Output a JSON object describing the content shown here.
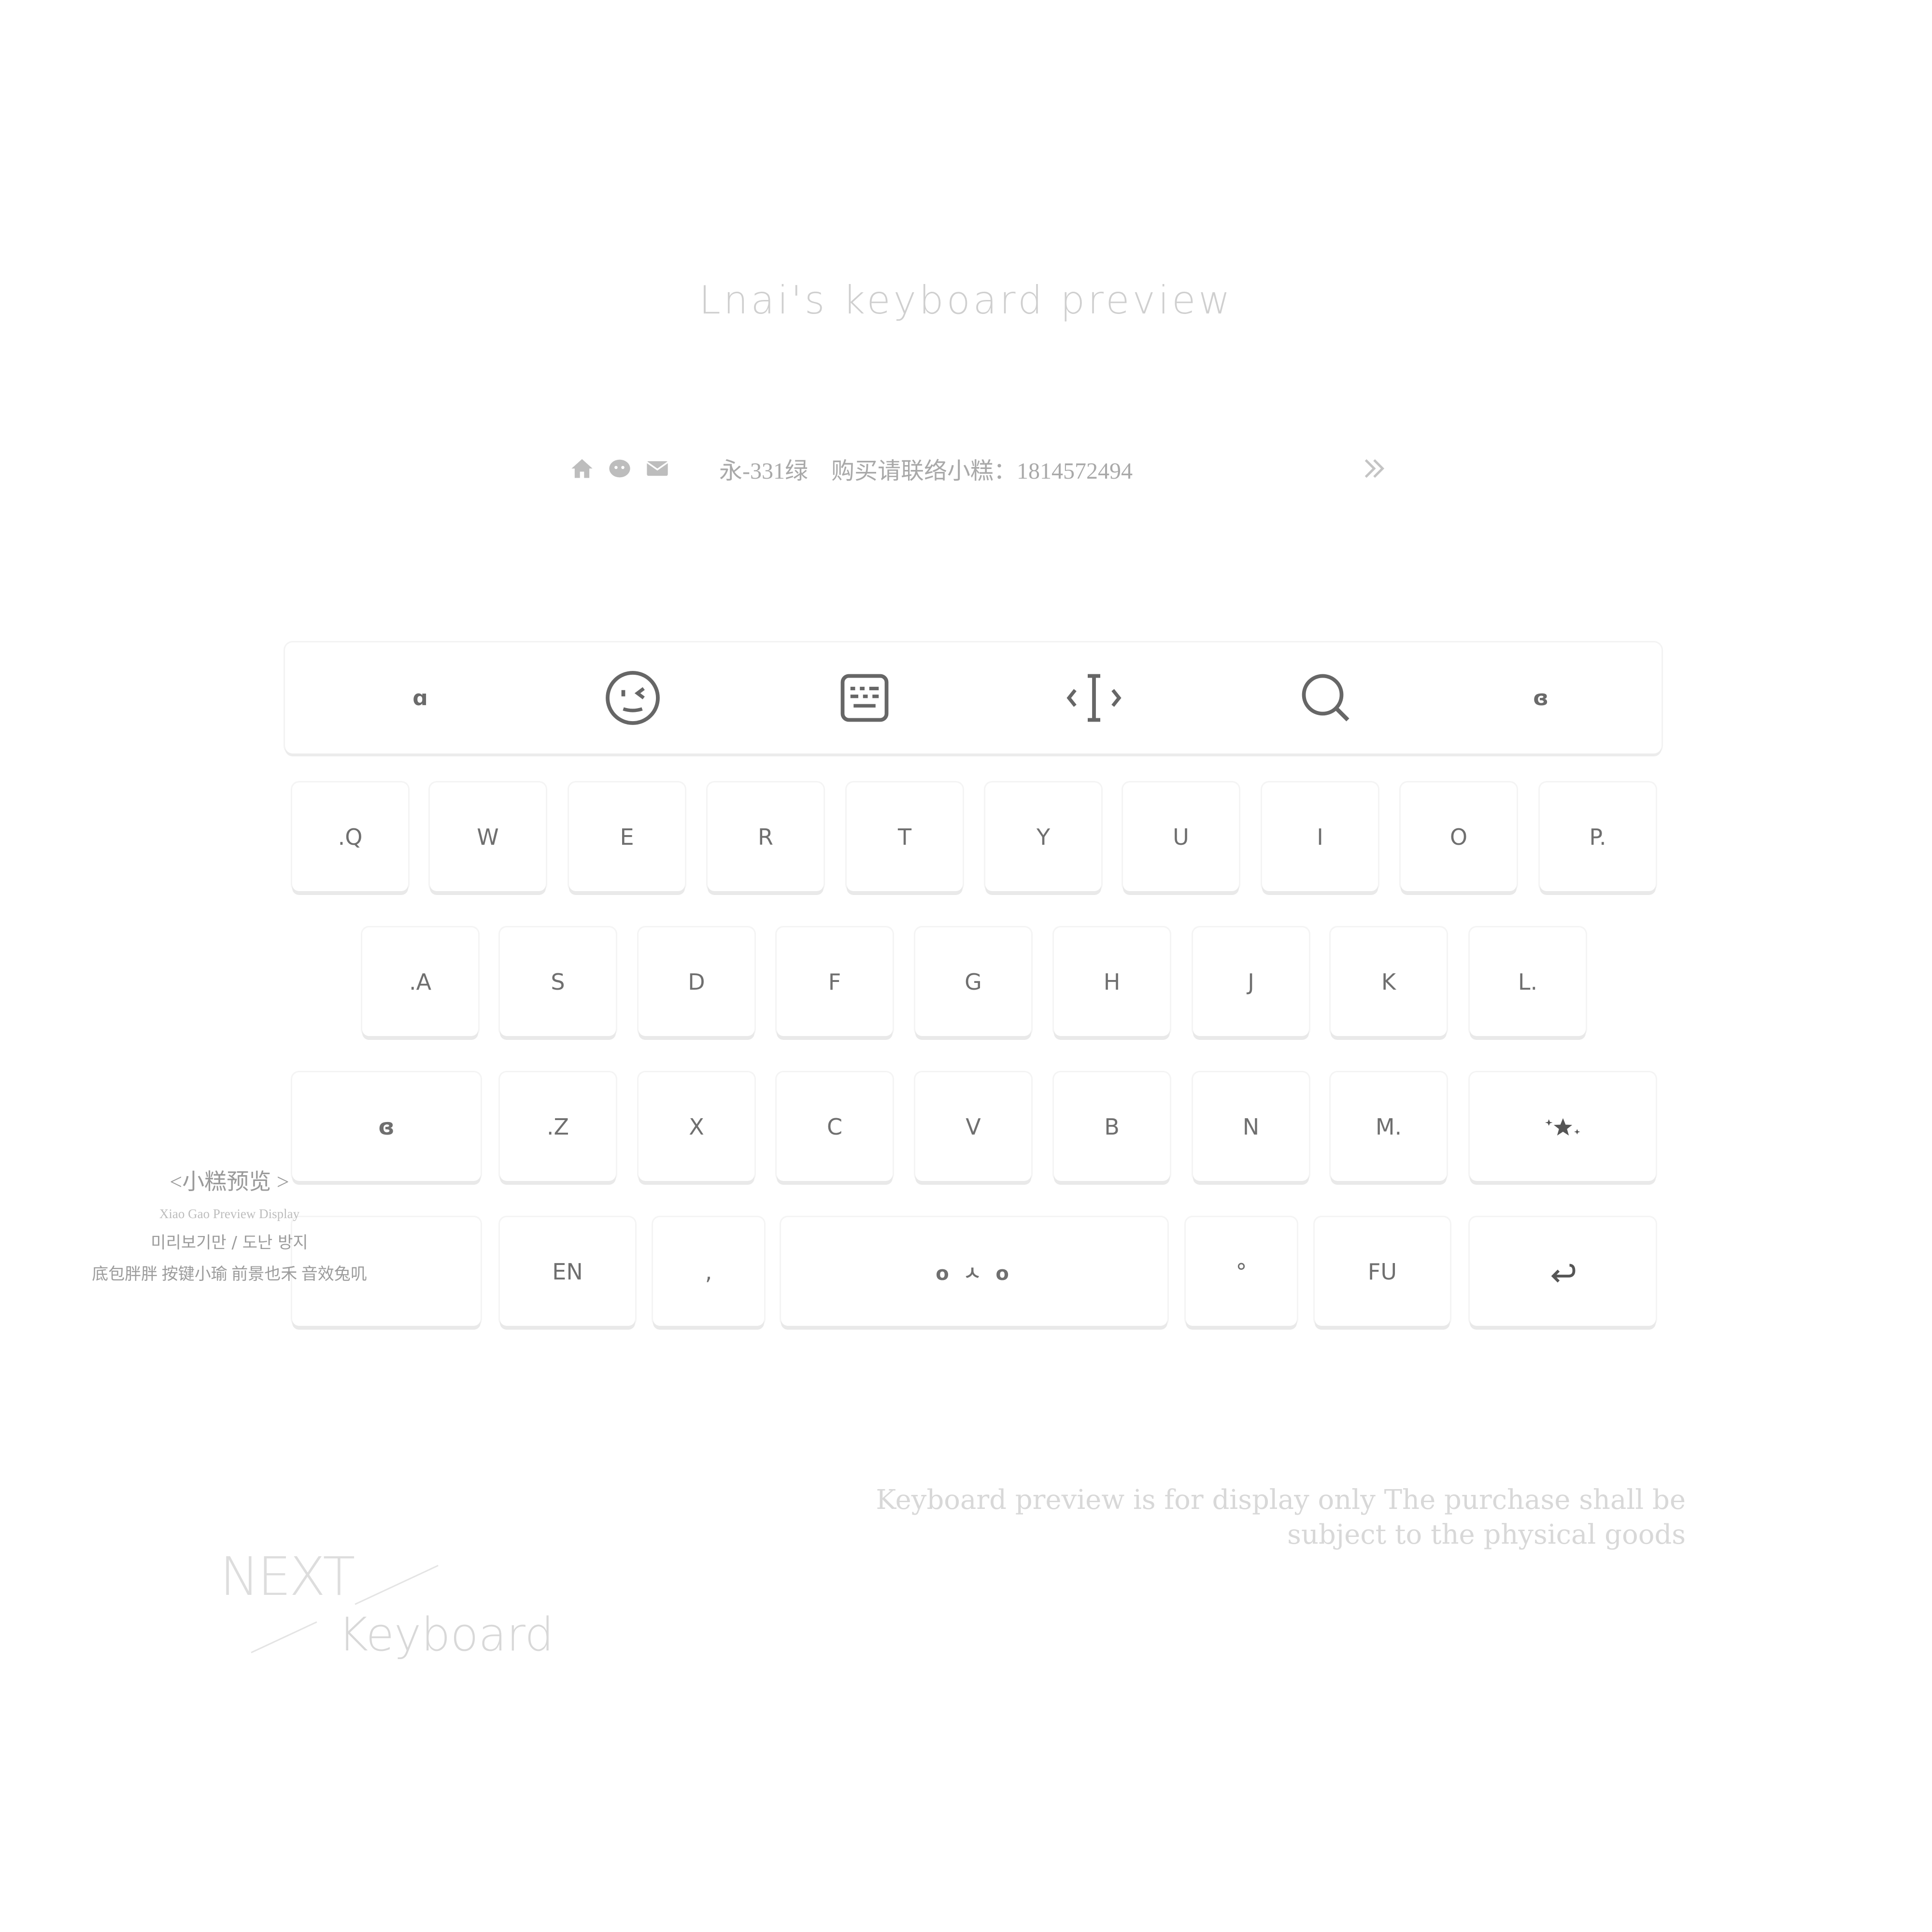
{
  "title": "Lnai's keyboard preview",
  "infobar": {
    "icons": [
      "home-icon",
      "wechat-icon",
      "mail-icon"
    ],
    "code": "永-331绿",
    "contact": "购买请联络小糕：1814572494",
    "more_icon": "double-chevron-right-icon"
  },
  "toolbar": {
    "icons": [
      "left-glyph-icon",
      "wink-face-icon",
      "keyboard-panel-icon",
      "cursor-move-icon",
      "search-icon",
      "right-glyph-icon"
    ],
    "left_glyph": "ɑ",
    "right_glyph": "ɞ"
  },
  "keyboard": {
    "row1": [
      ".Q",
      "W",
      "E",
      "R",
      "T",
      "Y",
      "U",
      "I",
      "O",
      "P."
    ],
    "row2": [
      ".A",
      "S",
      "D",
      "F",
      "G",
      "H",
      "J",
      "K",
      "L."
    ],
    "row3": {
      "shift_glyph": "ɞ",
      "letters": [
        ".Z",
        "X",
        "C",
        "V",
        "B",
        "N",
        "M."
      ],
      "special_icon": "sparkle-star-icon"
    },
    "row4": {
      "lang": "EN",
      "comma": ",",
      "space": "o ㅅ o",
      "period": "°",
      "fu": "FU",
      "enter_icon": "return-arrow-icon"
    }
  },
  "side_panel": {
    "heading": "<小糕预览 >",
    "subtitle": "Xiao Gao  Preview Display",
    "korean": "미리보기만 / 도난 방지",
    "credits": "底包胖胖 按键小瑜 前景也禾 音效兔叽"
  },
  "disclaimer": [
    "Keyboard preview is for display only The purchase shall be",
    "subject to the physical goods"
  ],
  "brand": {
    "next": "NEXT",
    "keyboard": "Keyboard"
  }
}
